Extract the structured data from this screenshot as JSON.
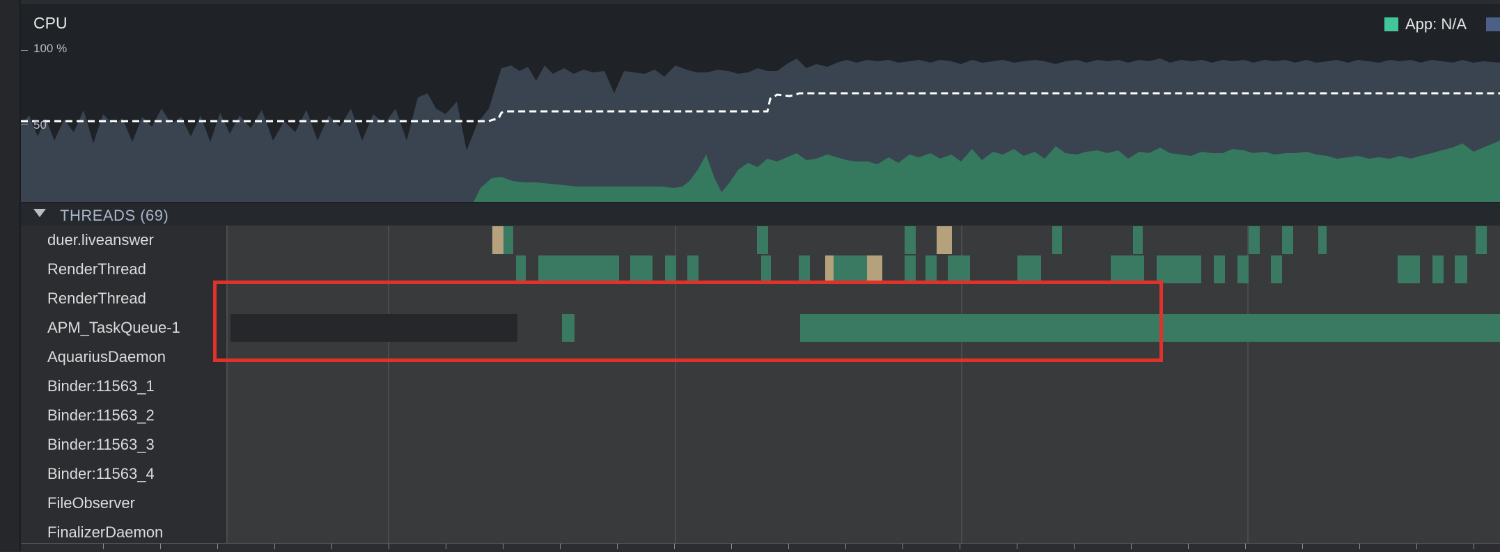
{
  "cpu": {
    "title": "CPU",
    "axis_100": "100 %",
    "axis_50": "50",
    "legend": [
      {
        "label": "App: N/A",
        "color": "#43c59a"
      },
      {
        "label": "",
        "color": "#4c5f86"
      }
    ]
  },
  "threads": {
    "title": "THREADS (69)",
    "items": [
      "duer.liveanswer",
      "RenderThread",
      "RenderThread",
      "APM_TaskQueue-1",
      "AquariusDaemon",
      "Binder:11563_1",
      "Binder:11563_2",
      "Binder:11563_3",
      "Binder:11563_4",
      "FileObserver",
      "FinalizerDaemon"
    ]
  },
  "colors": {
    "running": "#3a7a62",
    "runnable": "#b5a27c",
    "sleeping": "#25272b",
    "selection": "#e0322b"
  }
}
